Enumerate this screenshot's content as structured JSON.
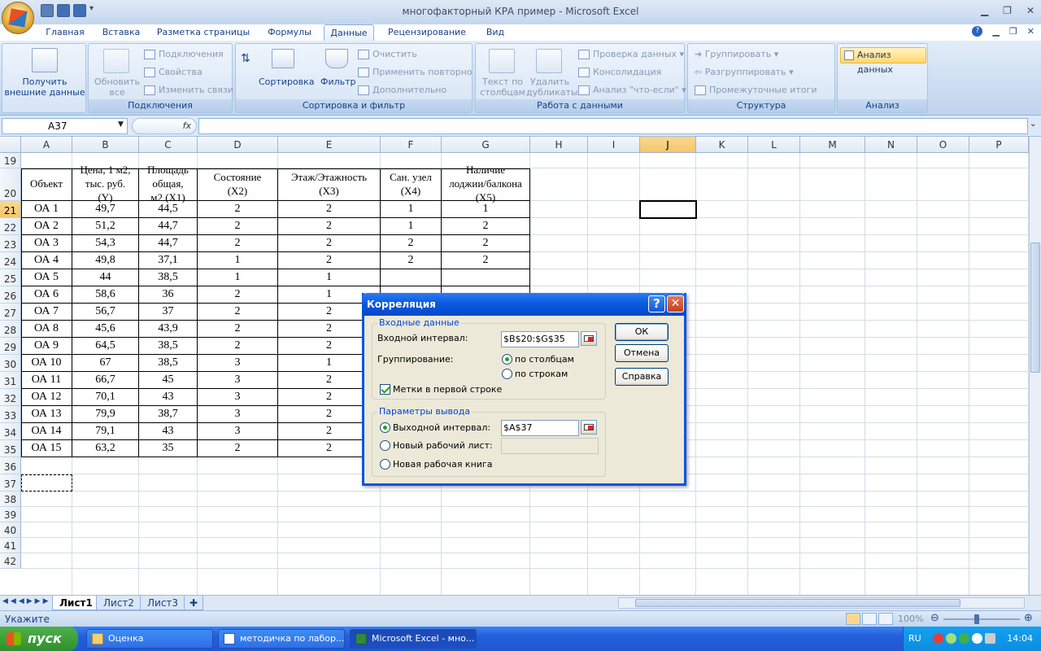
{
  "window": {
    "title": "многофакторный КРА пример - Microsoft Excel"
  },
  "ribbon": {
    "tabs": [
      "Главная",
      "Вставка",
      "Разметка страницы",
      "Формулы",
      "Данные",
      "Рецензирование",
      "Вид"
    ],
    "active_tab": "Данные",
    "groups": {
      "external": {
        "button": "Получить внешние данные"
      },
      "connections": {
        "label": "Подключения",
        "refresh": "Обновить все",
        "items": [
          "Подключения",
          "Свойства",
          "Изменить связи"
        ]
      },
      "sort_filter": {
        "label": "Сортировка и фильтр",
        "sort": "Сортировка",
        "filter": "Фильтр",
        "items": [
          "Очистить",
          "Применить повторно",
          "Дополнительно"
        ]
      },
      "data_tools": {
        "label": "Работа с данными",
        "text_to_cols": "Текст по столбцам",
        "remove_dups": "Удалить дубликаты",
        "items": [
          "Проверка данных",
          "Консолидация",
          "Анализ \"что-если\""
        ]
      },
      "outline": {
        "label": "Структура",
        "items": [
          "Группировать",
          "Разгруппировать",
          "Промежуточные итоги"
        ]
      },
      "analysis": {
        "label": "Анализ",
        "button": "Анализ данных"
      }
    }
  },
  "formula_bar": {
    "name_box": "A37",
    "fx": "fx",
    "formula": ""
  },
  "grid": {
    "columns": [
      "A",
      "B",
      "C",
      "D",
      "E",
      "F",
      "G",
      "H",
      "I",
      "J",
      "K",
      "L",
      "M",
      "N",
      "O",
      "P"
    ],
    "selected_column": "J",
    "rows": [
      "19",
      "20",
      "21",
      "22",
      "23",
      "24",
      "25",
      "26",
      "27",
      "28",
      "29",
      "30",
      "31",
      "32",
      "33",
      "34",
      "35",
      "36",
      "37",
      "38",
      "39",
      "40",
      "41",
      "42"
    ],
    "selected_row": "21",
    "table_headers": [
      "Объект",
      "Цена, 1 м2,\nтыс. руб.\n(Y)",
      "Площадь\nобщая,\nм2 (X1)",
      "Состояние\n(X2)",
      "Этаж/Этажность\n(X3)",
      "Сан. узел\n(X4)",
      "Наличие\nлоджии/балкона\n(X5)"
    ],
    "table_rows": [
      [
        "ОА 1",
        "49,7",
        "44,5",
        "2",
        "2",
        "1",
        "1"
      ],
      [
        "ОА 2",
        "51,2",
        "44,7",
        "2",
        "2",
        "1",
        "2"
      ],
      [
        "ОА 3",
        "54,3",
        "44,7",
        "2",
        "2",
        "2",
        "2"
      ],
      [
        "ОА 4",
        "49,8",
        "37,1",
        "1",
        "2",
        "2",
        "2"
      ],
      [
        "ОА 5",
        "44",
        "38,5",
        "1",
        "1",
        "",
        ""
      ],
      [
        "ОА 6",
        "58,6",
        "36",
        "2",
        "1",
        "",
        ""
      ],
      [
        "ОА 7",
        "56,7",
        "37",
        "2",
        "2",
        "",
        ""
      ],
      [
        "ОА 8",
        "45,6",
        "43,9",
        "2",
        "2",
        "",
        ""
      ],
      [
        "ОА 9",
        "64,5",
        "38,5",
        "2",
        "2",
        "",
        ""
      ],
      [
        "ОА 10",
        "67",
        "38,5",
        "3",
        "1",
        "",
        ""
      ],
      [
        "ОА 11",
        "66,7",
        "45",
        "3",
        "2",
        "",
        ""
      ],
      [
        "ОА 12",
        "70,1",
        "43",
        "3",
        "2",
        "",
        ""
      ],
      [
        "ОА 13",
        "79,9",
        "38,7",
        "3",
        "2",
        "",
        ""
      ],
      [
        "ОА 14",
        "79,1",
        "43",
        "3",
        "2",
        "",
        ""
      ],
      [
        "ОА 15",
        "63,2",
        "35",
        "2",
        "2",
        "",
        ""
      ]
    ]
  },
  "sheets": {
    "tabs": [
      "Лист1",
      "Лист2",
      "Лист3"
    ],
    "active": "Лист1"
  },
  "status": {
    "text": "Укажите",
    "zoom": "100%"
  },
  "dialog": {
    "title": "Корреляция",
    "input_section": "Входные данные",
    "input_range_label": "Входной интервал:",
    "input_range_value": "$B$20:$G$35",
    "grouping_label": "Группирование:",
    "by_columns": "по столбцам",
    "by_rows": "по строкам",
    "grouping_selected": "по столбцам",
    "labels_first_row": "Метки в первой строке",
    "labels_checked": true,
    "output_section": "Параметры вывода",
    "output_range_label": "Выходной интервал:",
    "output_range_value": "$A$37",
    "new_sheet_label": "Новый рабочий лист:",
    "new_book_label": "Новая рабочая книга",
    "ok": "ОК",
    "cancel": "Отмена",
    "help": "Справка"
  },
  "taskbar": {
    "start": "пуск",
    "tasks": [
      "Оценка",
      "методичка по лабор...",
      "Microsoft Excel - мно..."
    ],
    "lang": "RU",
    "clock": "14:04"
  }
}
